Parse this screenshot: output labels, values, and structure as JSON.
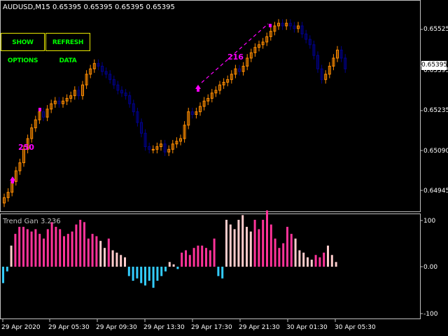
{
  "window": {
    "title": "AUDUSD,M15  0.65395 0.65395 0.65395 0.65395"
  },
  "buttons": {
    "show_options": "SHOW OPTIONS",
    "refresh_data": "REFRESH DATA"
  },
  "indicator": {
    "title": "Trend Gan 3.236"
  },
  "price_axis": {
    "labels": [
      "0.65525",
      "0.65395",
      "0.65355",
      "0.65235",
      "0.65090",
      "0.64945"
    ],
    "current": "0.65395"
  },
  "indicator_axis": {
    "labels": [
      "100",
      "0.00",
      "-100"
    ]
  },
  "time_axis": {
    "labels": [
      "29 Apr 2020",
      "29 Apr 05:30",
      "29 Apr 09:30",
      "29 Apr 13:30",
      "29 Apr 17:30",
      "29 Apr 21:30",
      "30 Apr 01:30",
      "30 Apr 05:30"
    ]
  },
  "annotations": {
    "low_count": "250",
    "high_count": "216"
  },
  "colors": {
    "bull_candle": "#ff8c00",
    "bear_candle": "#00008b",
    "pink": "#ff3399",
    "light_pink": "#ffcccc",
    "cyan": "#33ccff",
    "magenta": "#ff00ff",
    "grid": "#c0c0c0"
  },
  "chart_data": {
    "type": "candlestick_with_histogram",
    "price_range": [
      0.649,
      0.6562
    ],
    "close": [
      0.6492,
      0.6494,
      0.6498,
      0.6502,
      0.6505,
      0.651,
      0.6514,
      0.6518,
      0.6521,
      0.6524,
      0.6522,
      0.6525,
      0.6527,
      0.6528,
      0.6527,
      0.6528,
      0.6529,
      0.653,
      0.6532,
      0.653,
      0.6534,
      0.6538,
      0.654,
      0.6542,
      0.6541,
      0.6539,
      0.6538,
      0.6536,
      0.6534,
      0.6532,
      0.6531,
      0.653,
      0.6527,
      0.6524,
      0.652,
      0.6516,
      0.6511,
      0.651,
      0.651,
      0.6511,
      0.6512,
      0.6509,
      0.651,
      0.6512,
      0.6513,
      0.6514,
      0.6519,
      0.6524,
      0.6523,
      0.6524,
      0.6526,
      0.6528,
      0.6529,
      0.6531,
      0.6532,
      0.6534,
      0.6535,
      0.6536,
      0.6538,
      0.654,
      0.6539,
      0.6541,
      0.6544,
      0.6546,
      0.6548,
      0.6549,
      0.655,
      0.6552,
      0.6554,
      0.6556,
      0.6557,
      0.6556,
      0.6557,
      0.6556,
      0.6555,
      0.6556,
      0.6553,
      0.6551,
      0.6549,
      0.6545,
      0.654,
      0.6536,
      0.6538,
      0.6541,
      0.6544,
      0.6547,
      0.6544,
      0.654
    ],
    "indicator": [
      -35,
      -10,
      45,
      70,
      85,
      85,
      80,
      75,
      80,
      70,
      60,
      80,
      95,
      85,
      80,
      65,
      70,
      75,
      90,
      100,
      95,
      60,
      70,
      65,
      55,
      40,
      60,
      35,
      30,
      25,
      20,
      -20,
      -30,
      -25,
      -35,
      -40,
      -30,
      -45,
      -30,
      -20,
      -10,
      10,
      5,
      -5,
      30,
      35,
      25,
      40,
      45,
      45,
      40,
      35,
      60,
      -20,
      -25,
      100,
      90,
      80,
      100,
      110,
      85,
      75,
      100,
      80,
      100,
      120,
      90,
      60,
      40,
      50,
      85,
      70,
      60,
      35,
      30,
      20,
      15,
      25,
      20,
      30,
      45,
      25,
      10
    ],
    "ind_range": [
      -100,
      100
    ]
  }
}
